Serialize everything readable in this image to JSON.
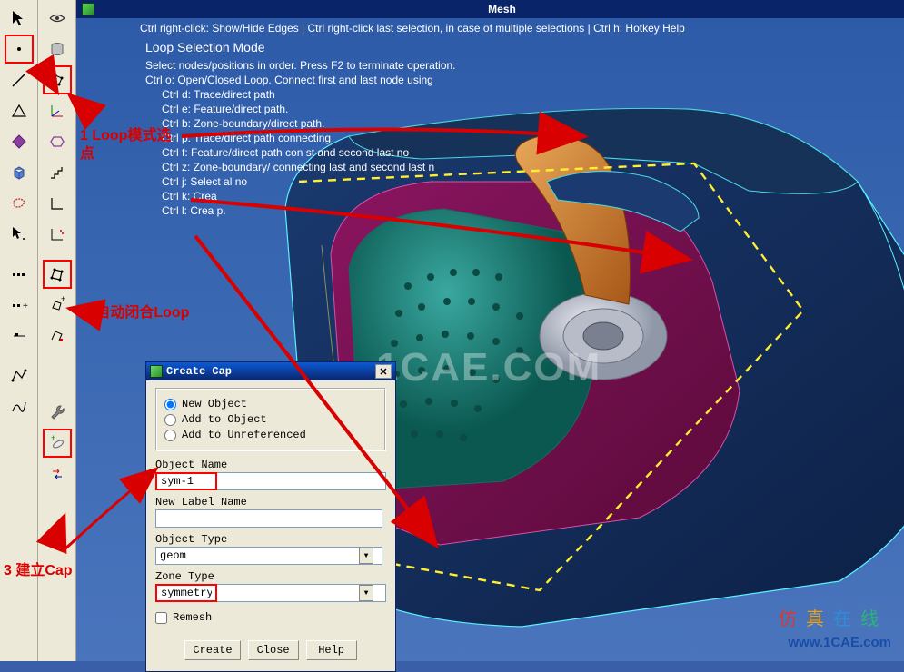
{
  "title": "Mesh",
  "hint_bar": "Ctrl right-click: Show/Hide Edges | Ctrl right-click last selection, in case of multiple selections | Ctrl h: Hotkey Help",
  "hints": {
    "title": "Loop Selection Mode",
    "lines": [
      "Select nodes/positions in order. Press F2 to terminate operation.",
      "Ctrl o: Open/Closed Loop. Connect first and last node using",
      "Ctrl d: Trace/direct path",
      "Ctrl e: Feature/direct path.",
      "Ctrl b: Zone-boundary/direct path.",
      "Ctrl p: Trace/direct path connecting",
      "Ctrl f: Feature/direct path con                st and second last no",
      "Ctrl z: Zone-boundary/              connecting last and second last n",
      "Ctrl j: Select al no",
      "Ctrl k: Crea",
      "Ctrl l: Crea                p."
    ]
  },
  "watermark": "1CAE.COM",
  "annotations": {
    "a1": "1 Loop模式选点",
    "a2": "2 自动闭合Loop",
    "a3": "3 建立Cap"
  },
  "dialog": {
    "title": "Create Cap",
    "radio": {
      "new_object": "New Object",
      "add_object": "Add to Object",
      "add_unref": "Add to Unreferenced"
    },
    "labels": {
      "obj_name": "Object Name",
      "new_label": "New Label Name",
      "obj_type": "Object Type",
      "zone_type": "Zone Type",
      "remesh": "Remesh"
    },
    "values": {
      "obj_name": "sym-1",
      "new_label": "",
      "obj_type": "geom",
      "zone_type": "symmetry"
    },
    "buttons": {
      "create": "Create",
      "close": "Close",
      "help": "Help"
    }
  },
  "brand": {
    "cn": [
      "仿",
      "真",
      "在",
      "线"
    ],
    "url": "www.1CAE.com"
  },
  "colors": {
    "annotation": "#d80000",
    "highlight": "#ff0000",
    "titlebar": "#0a246a"
  }
}
